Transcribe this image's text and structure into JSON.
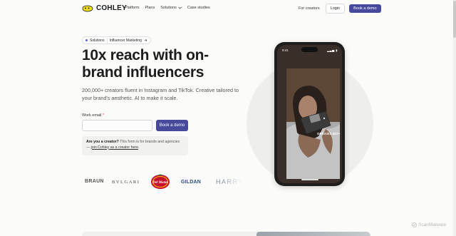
{
  "brand": {
    "name": "COHLEY",
    "logo_color": "#f2df1b"
  },
  "nav": {
    "links": [
      {
        "label": "Platform"
      },
      {
        "label": "Plans"
      },
      {
        "label": "Solutions",
        "dropdown": true
      },
      {
        "label": "Case studies"
      }
    ],
    "for_creators": "For creators",
    "login": "Login",
    "demo": "Book a demo"
  },
  "hero": {
    "breadcrumb": {
      "parent": "Solutions",
      "current": "Influencer Marketing"
    },
    "headline": "10x reach with on-brand influencers",
    "subtext": "200,000+ creators fluent in Instagram and TikTok. Creative tailored to your brand's aesthetic. AI to make it scale.",
    "form": {
      "label": "Work email",
      "required_mark": "*",
      "value": "",
      "placeholder": "",
      "submit": "Book a demo"
    },
    "creator_note": {
      "bold": "Are you a creator?",
      "text": " This form is for brands and agencies — ",
      "link": "join Cohley as a creator here",
      "end": "."
    }
  },
  "brands": [
    "BRAUN",
    "BVLGARI",
    "Del Monte",
    "GILDAN",
    "HARRY"
  ],
  "phone": {
    "time": "9:41",
    "overlay_text": "ORRASIS BIO+"
  },
  "watermark": "ScanMalware",
  "colors": {
    "accent": "#474a9c",
    "background": "#fbfbfa"
  }
}
